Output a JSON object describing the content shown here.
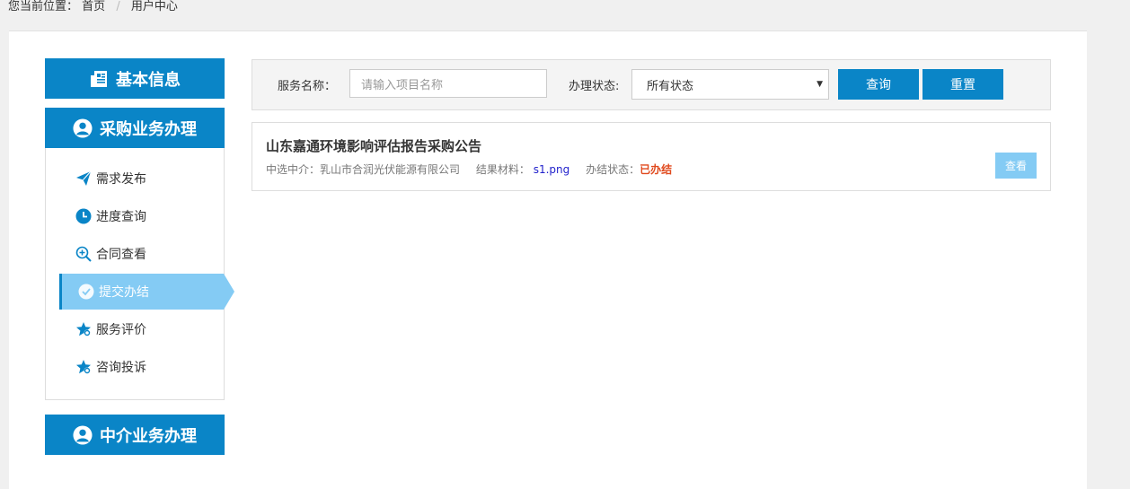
{
  "breadcrumb": {
    "prefix": "您当前位置：",
    "home": "首页",
    "separator": "/",
    "current": "用户中心"
  },
  "sidebar": {
    "basic_info": {
      "label": "基本信息",
      "icon": "newspaper-icon"
    },
    "procurement": {
      "label": "采购业务办理",
      "icon": "user-icon"
    },
    "items": [
      {
        "label": "需求发布",
        "icon": "paper-plane-icon"
      },
      {
        "label": "进度查询",
        "icon": "clock-icon"
      },
      {
        "label": "合同查看",
        "icon": "zoom-in-icon"
      },
      {
        "label": "提交办结",
        "icon": "check-circle-icon",
        "active": true
      },
      {
        "label": "服务评价",
        "icon": "star-gear-icon"
      },
      {
        "label": "咨询投诉",
        "icon": "star-gear-icon"
      }
    ],
    "agency": {
      "label": "中介业务办理",
      "icon": "user-icon"
    }
  },
  "search": {
    "service_label": "服务名称：",
    "service_placeholder": "请输入项目名称",
    "status_label": "办理状态:",
    "status_value": "所有状态",
    "query_button": "查询",
    "reset_button": "重置"
  },
  "results": [
    {
      "title": "山东嘉通环境影响评估报告采购公告",
      "agency_label": "中选中介：",
      "agency_value": "乳山市合润光伏能源有限公司",
      "file_label": "结果材料：",
      "file_value": "s1.png",
      "status_label": "办结状态：",
      "status_value": "已办结",
      "view_button": "查看"
    }
  ],
  "colors": {
    "primary": "#0a85c7",
    "active_light": "#84cbf4",
    "status_done": "#e04a1e",
    "file_link": "#2222cc"
  }
}
